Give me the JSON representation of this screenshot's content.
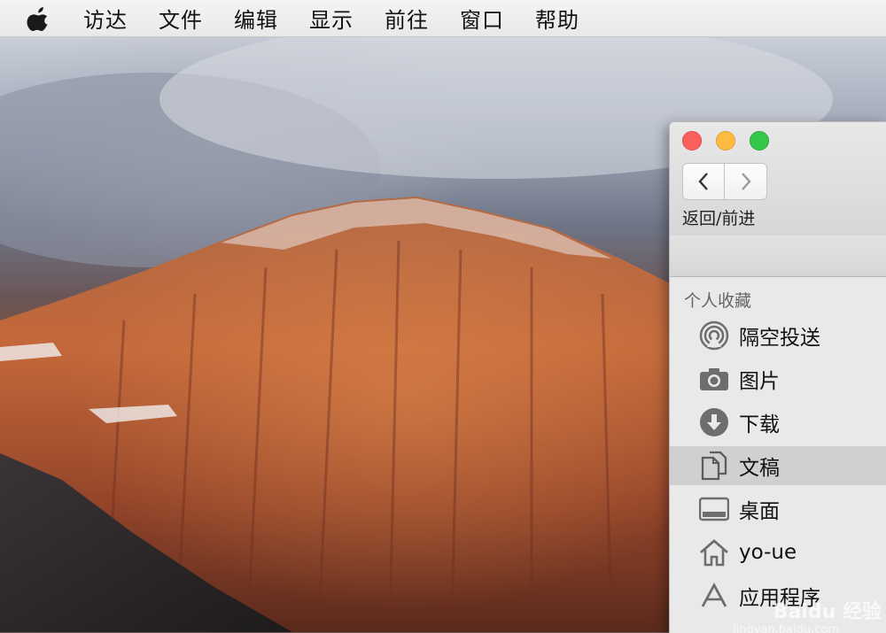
{
  "menubar": {
    "items": [
      "访达",
      "文件",
      "编辑",
      "显示",
      "前往",
      "窗口",
      "帮助"
    ]
  },
  "finder": {
    "nav_caption": "返回/前进",
    "sidebar": {
      "section_title": "个人收藏",
      "items": [
        {
          "label": "隔空投送",
          "icon": "airdrop-icon"
        },
        {
          "label": "图片",
          "icon": "camera-icon"
        },
        {
          "label": "下载",
          "icon": "download-icon"
        },
        {
          "label": "文稿",
          "icon": "document-icon",
          "selected": true
        },
        {
          "label": "桌面",
          "icon": "desktop-icon"
        },
        {
          "label": "yo-ue",
          "icon": "home-icon"
        },
        {
          "label": "应用程序",
          "icon": "applications-icon"
        }
      ]
    },
    "watermark": "Baidu 经验",
    "watermark_sub": "jingyan.baidu.com"
  }
}
